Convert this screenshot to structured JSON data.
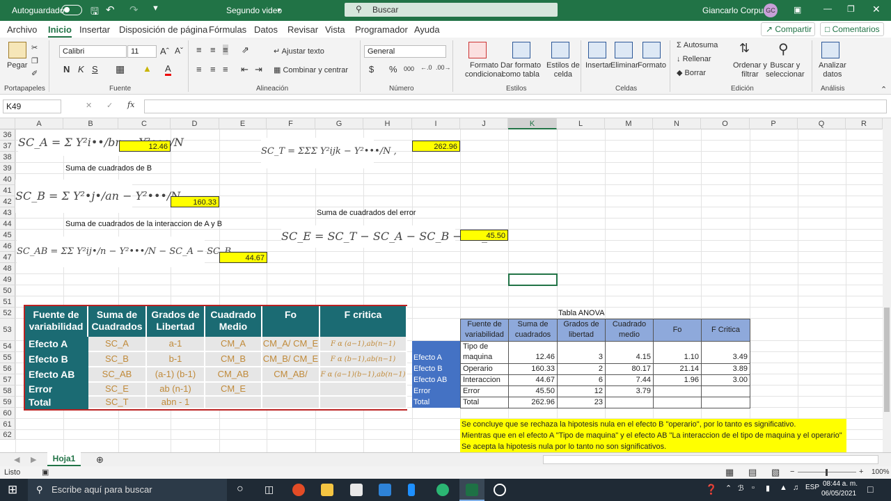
{
  "titlebar": {
    "autosave": "Autoguardado",
    "filename": "Segundo video",
    "search": "Buscar",
    "user": "Giancarlo Corpus",
    "initials": "GC"
  },
  "menu": [
    "Archivo",
    "Inicio",
    "Insertar",
    "Disposición de página",
    "Fórmulas",
    "Datos",
    "Revisar",
    "Vista",
    "Programador",
    "Ayuda"
  ],
  "share": "Compartir",
  "comments": "Comentarios",
  "ribbon": {
    "paste": "Pegar",
    "font_name": "Calibri",
    "font_size": "11",
    "wrap": "Ajustar texto",
    "merge": "Combinar y centrar",
    "number_format": "General",
    "cond_format": [
      "Formato",
      "condicional"
    ],
    "table_format": [
      "Dar formato",
      "como tabla"
    ],
    "cell_styles": [
      "Estilos de",
      "celda"
    ],
    "insert": "Insertar",
    "delete": "Eliminar",
    "format": "Formato",
    "autosum": "Autosuma",
    "fill": "Rellenar",
    "clear": "Borrar",
    "sort": [
      "Ordenar y",
      "filtrar"
    ],
    "find": [
      "Buscar y",
      "seleccionar"
    ],
    "analyze": [
      "Analizar",
      "datos"
    ],
    "groups": [
      "Portapapeles",
      "Fuente",
      "Alineación",
      "Número",
      "Estilos",
      "Celdas",
      "Edición",
      "Análisis"
    ]
  },
  "namebox": "K49",
  "fx": "fx",
  "columns": [
    "A",
    "B",
    "C",
    "D",
    "E",
    "F",
    "G",
    "H",
    "I",
    "J",
    "K",
    "L",
    "M",
    "N",
    "O",
    "P",
    "Q",
    "R"
  ],
  "rows": [
    "36",
    "37",
    "38",
    "39",
    "40",
    "41",
    "42",
    "43",
    "44",
    "45",
    "46",
    "47",
    "48",
    "49",
    "50",
    "51",
    "52",
    "53",
    "54",
    "55",
    "56",
    "57",
    "58",
    "59",
    "60",
    "61",
    "62"
  ],
  "cells": {
    "sca_value": "12.46",
    "sct_value": "262.96",
    "scb_label": "Suma de cuadrados de B",
    "scb_value": "160.33",
    "sce_label": "Suma de cuadrados del error",
    "scab_label": "Suma de cuadrados de la interaccion de A y B",
    "sce_value": "45.50",
    "scab_value": "44.67"
  },
  "formulas": {
    "sca": "SC_A = Σ Y²i••/bn − Y²•••/N",
    "sct": "SC_T = ΣΣΣ Y²ijk − Y²•••/N ,",
    "scb": "SC_B = Σ Y²•j•/an − Y²•••/N",
    "sce": "SC_E = SC_T − SC_A − SC_B − SC_AB.",
    "scab": "SC_AB = ΣΣ Y²ij•/n − Y²•••/N − SC_A − SC_B"
  },
  "image_table": {
    "headers": [
      "Fuente de variabilidad",
      "Suma de Cuadrados",
      "Grados de Libertad",
      "Cuadrado Medio",
      "Fo",
      "F critica"
    ],
    "rows": [
      [
        "Efecto A",
        "SC_A",
        "a-1",
        "CM_A",
        "CM_A/ CM_E",
        "F α (a−1),ab(n−1)"
      ],
      [
        "Efecto B",
        "SC_B",
        "b-1",
        "CM_B",
        "CM_B/ CM_E",
        "F α (b−1),ab(n−1)"
      ],
      [
        "Efecto AB",
        "SC_AB",
        "(a-1) (b-1)",
        "CM_AB",
        "CM_AB/ CM_E",
        "F α (a−1)(b−1),ab(n−1)"
      ],
      [
        "Error",
        "SC_E",
        "ab (n-1)",
        "CM_E",
        "",
        ""
      ],
      [
        "Total",
        "SC_T",
        "abn - 1",
        "",
        "",
        ""
      ]
    ]
  },
  "anova": {
    "title": "Tabla ANOVA",
    "headers": [
      "Fuente de variabilidad",
      "Suma de cuadrados",
      "Grados de libertad",
      "Cuadrado medio",
      "Fo",
      "F Critica"
    ],
    "labels": [
      "Efecto A",
      "Efecto B",
      "Efecto AB",
      "Error",
      "Total"
    ],
    "rows": [
      [
        "Tipo de maquina",
        "12.46",
        "3",
        "4.15",
        "1.10",
        "3.49"
      ],
      [
        "Operario",
        "160.33",
        "2",
        "80.17",
        "21.14",
        "3.89"
      ],
      [
        "Interaccion",
        "44.67",
        "6",
        "7.44",
        "1.96",
        "3.00"
      ],
      [
        "Error",
        "45.50",
        "12",
        "3.79",
        "",
        ""
      ],
      [
        "Total",
        "262.96",
        "23",
        "",
        "",
        ""
      ]
    ]
  },
  "conclusions": [
    "Se concluye que se rechaza la hipotesis nula en el efecto B \"operario\", por lo tanto es significativo.",
    "Mientras que en el efecto A \"Tipo de maquina\" y el efecto AB \"La interaccion de el tipo de maquina y el operario\"",
    "Se acepta la hipotesis nula por lo tanto no son significativos."
  ],
  "sheet_tab": "Hoja1",
  "status": {
    "ready": "Listo",
    "zoom": "100%"
  },
  "taskbar": {
    "search": "Escribe aquí para buscar",
    "time": "08:44 a. m.",
    "date": "06/05/2021"
  },
  "colors": {
    "excel_green": "#217346",
    "highlight": "#ffff00",
    "teal": "#1b6b73",
    "anova_header": "#8ea9db",
    "anova_label": "#4472c4"
  }
}
